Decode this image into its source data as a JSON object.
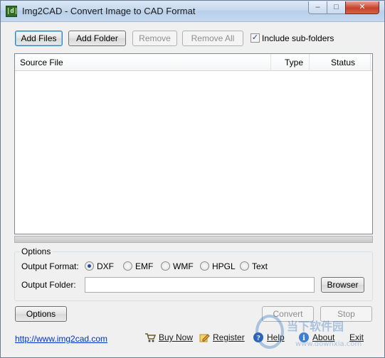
{
  "window": {
    "title": "Img2CAD - Convert Image to CAD Format",
    "icon": "app-icon",
    "controls": {
      "minimize": "–",
      "maximize": "□",
      "close": "✕"
    }
  },
  "toolbar": {
    "add_files": "Add Files",
    "add_folder": "Add Folder",
    "remove": "Remove",
    "remove_all": "Remove All",
    "include_subfolders": {
      "label": "Include sub-folders",
      "checked": true,
      "mark": "✓"
    }
  },
  "file_list": {
    "columns": [
      "Source File",
      "Type",
      "Status"
    ],
    "rows": []
  },
  "options": {
    "group_title": "Options",
    "output_format_label": "Output Format:",
    "formats": [
      {
        "label": "DXF",
        "selected": true
      },
      {
        "label": "EMF",
        "selected": false
      },
      {
        "label": "WMF",
        "selected": false
      },
      {
        "label": "HPGL",
        "selected": false
      },
      {
        "label": "Text",
        "selected": false
      }
    ],
    "output_folder_label": "Output Folder:",
    "output_folder_value": "",
    "browser_button": "Browser"
  },
  "bottom_buttons": {
    "options": "Options",
    "convert": "Convert",
    "stop": "Stop"
  },
  "footer": {
    "website": "http://www.img2cad.com",
    "buy_now": "Buy Now",
    "register": "Register",
    "help": "Help",
    "about": "About",
    "exit": "Exit"
  },
  "watermark": {
    "text_cn": "当下软件园",
    "text_url": "www.downxia.com"
  },
  "colors": {
    "accent": "#3c7fb1",
    "link": "#0033cc",
    "close_button": "#c7412b"
  }
}
